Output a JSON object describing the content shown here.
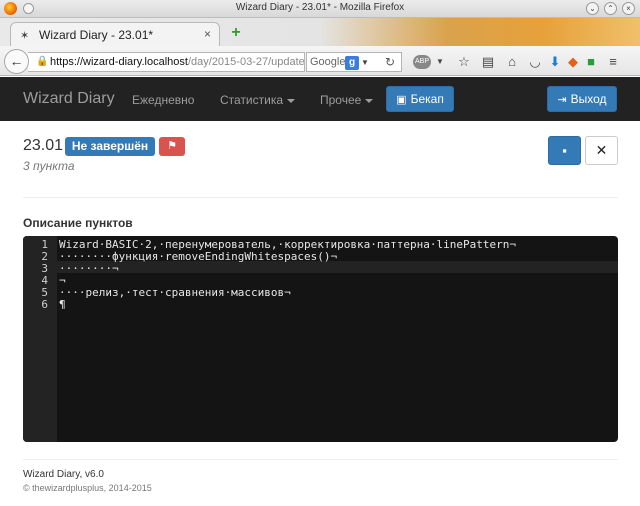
{
  "window": {
    "title": "Wizard Diary - 23.01* - Mozilla Firefox"
  },
  "browser": {
    "tab_label": "Wizard Diary - 23.01*",
    "tab_close": "×",
    "url_host": "https://wizard-diary.localhost",
    "url_path": "/day/2015-03-27/update",
    "search_engine": "Google",
    "search_engine_badge": "g"
  },
  "app": {
    "brand": "Wizard Diary",
    "nav": {
      "daily": "Ежедневно",
      "stats": "Статистика",
      "other": "Прочее",
      "backup": "Бекап",
      "logout": "Выход"
    }
  },
  "day": {
    "title": "23.01",
    "status": "Не завершён",
    "count": "3 пункта"
  },
  "section_title": "Описание пунктов",
  "editor": {
    "line_numbers": [
      "1",
      "2",
      "3",
      "4",
      "5",
      "6"
    ],
    "lines": [
      "Wizard·BASIC·2,·перенумерователь,·корректировка·паттерна·linePattern¬",
      "········функция·removeEndingWhitespaces()¬",
      "········¬",
      "¬",
      "····релиз,·тест·сравнения·массивов¬",
      "¶"
    ]
  },
  "footer": {
    "version": "Wizard Diary, v6.0",
    "copyright": "© thewizardplusplus, 2014-2015"
  },
  "colors": {
    "navbar_bg": "#222222",
    "primary": "#337ab7",
    "danger": "#d9534f",
    "editor_bg": "#141414"
  }
}
